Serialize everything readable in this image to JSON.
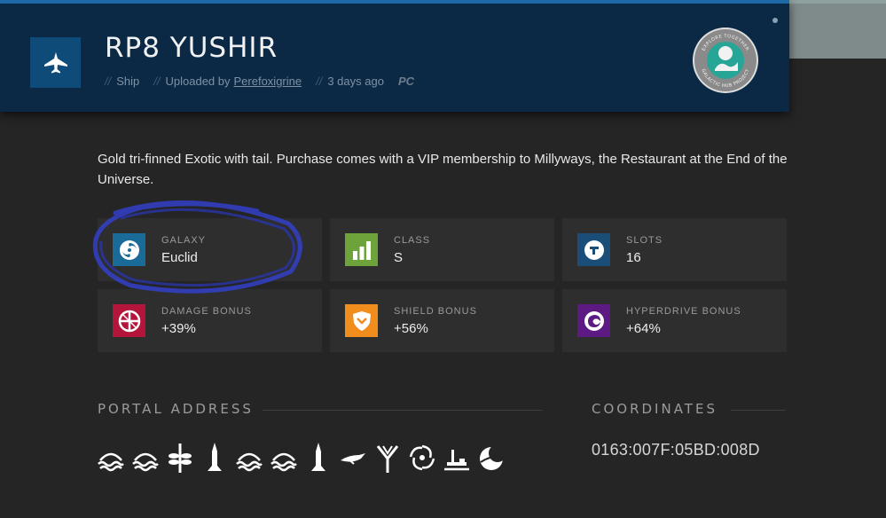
{
  "header": {
    "title": "RP8 YUSHIR",
    "type": "Ship",
    "uploaded_prefix": "Uploaded by",
    "uploader": "Perefoxigrine",
    "age": "3 days ago",
    "platform": "PC",
    "sep": "//",
    "type_icon": "fighter-jet-icon",
    "badge_top": "EXPLORE TOGETHER",
    "badge_bottom": "GALACTIC HUB PROJECT"
  },
  "description": "Gold tri-finned Exotic with tail. Purchase comes with a VIP membership to Millyways, the Restaurant at the End of the Universe.",
  "stats": [
    {
      "label": "GALAXY",
      "value": "Euclid",
      "icon": "galaxy-icon",
      "color": "#1b6b98"
    },
    {
      "label": "CLASS",
      "value": "S",
      "icon": "class-bars-icon",
      "color": "#6ea23a"
    },
    {
      "label": "SLOTS",
      "value": "16",
      "icon": "slots-icon",
      "color": "#1a4e79"
    },
    {
      "label": "DAMAGE BONUS",
      "value": "+39%",
      "icon": "damage-icon",
      "color": "#b3163a"
    },
    {
      "label": "SHIELD BONUS",
      "value": "+56%",
      "icon": "shield-icon",
      "color": "#f08d1d"
    },
    {
      "label": "HYPERDRIVE BONUS",
      "value": "+64%",
      "icon": "hyperdrive-icon",
      "color": "#5c1a82"
    }
  ],
  "portal": {
    "title": "PORTAL ADDRESS",
    "glyphs": [
      "boat-glyph",
      "boat-glyph",
      "dragonfly-glyph",
      "rocket-glyph",
      "boat-glyph",
      "boat-glyph",
      "rocket-glyph",
      "bird-glyph",
      "tree-glyph",
      "galaxy-glyph",
      "voxel-glyph",
      "eclipse-glyph"
    ]
  },
  "coordinates": {
    "title": "COORDINATES",
    "value": "0163:007F:05BD:008D"
  }
}
